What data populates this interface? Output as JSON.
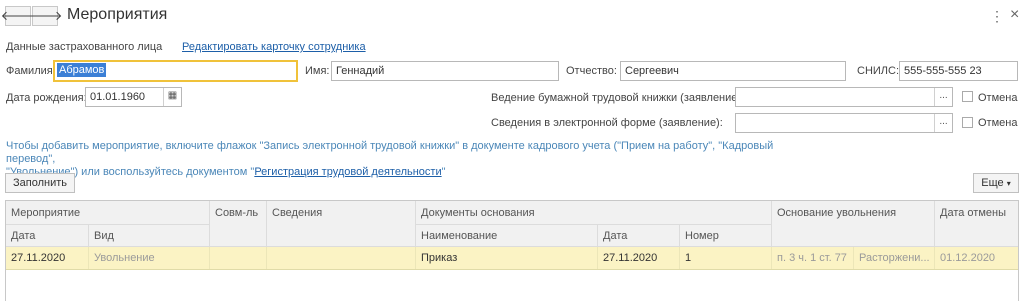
{
  "header": {
    "title": "Мероприятия",
    "back_glyph": "🡐",
    "forward_glyph": "🡒",
    "menu_glyph": "⋮",
    "close_glyph": "×"
  },
  "person": {
    "section_label": "Данные застрахованного лица",
    "edit_link": "Редактировать карточку сотрудника",
    "surname_label": "Фамилия:",
    "surname_value": "Абрамов",
    "name_label": "Имя:",
    "name_value": "Геннадий",
    "patronymic_label": "Отчество:",
    "patronymic_value": "Сергеевич",
    "snils_label": "СНИЛС:",
    "snils_value": "555-555-555 23",
    "birth_label": "Дата рождения:",
    "birth_value": "01.01.1960"
  },
  "statements": {
    "paper_label": "Ведение бумажной трудовой книжки (заявление):",
    "paper_value": "",
    "electronic_label": "Сведения в электронной форме (заявление):",
    "electronic_value": "",
    "cancel_label": "Отмена",
    "ellipsis": "..."
  },
  "hint": {
    "part1": "Чтобы добавить мероприятие, включите флажок \"Запись электронной трудовой книжки\" в документе кадрового учета (\"Прием на работу\", \"Кадровый перевод\",",
    "part2": "\"Увольнение\") или воспользуйтесь документом \"",
    "link": "Регистрация трудовой деятельности",
    "part3": "\""
  },
  "toolbar": {
    "fill_button": "Заполнить",
    "more_button": "Еще",
    "more_arrow": "▾"
  },
  "table": {
    "headers": {
      "event": "Мероприятие",
      "date": "Дата",
      "kind": "Вид",
      "combined": "Совм-ль",
      "info": "Сведения",
      "basis_docs": "Документы основания",
      "doc_name": "Наименование",
      "doc_date": "Дата",
      "doc_number": "Номер",
      "dismissal_basis": "Основание увольнения",
      "cancel_date": "Дата отмены"
    },
    "rows": [
      {
        "date": "27.11.2020",
        "kind": "Увольнение",
        "combined": "",
        "info": "",
        "doc_name": "Приказ",
        "doc_date": "27.11.2020",
        "doc_number": "1",
        "basis_article": "п. 3 ч. 1 ст. 77",
        "basis_text": "Расторжени...",
        "cancel_date": "01.12.2020"
      }
    ]
  }
}
